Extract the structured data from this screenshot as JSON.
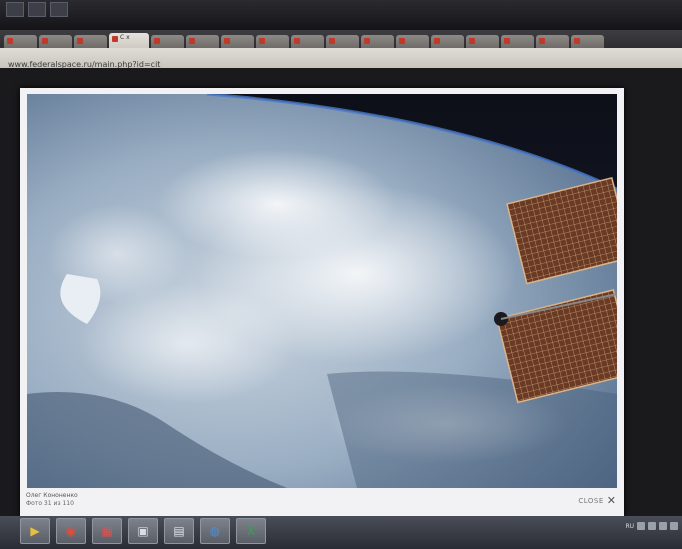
{
  "browser": {
    "url": "www.federalspace.ru/main.php?id=cit",
    "tabs_count": 17,
    "active_tab_label": "C  x"
  },
  "lightbox": {
    "caption_title": "Олег Кононенко",
    "caption_count": "Фото 31 из 110",
    "close_label": "CLOSE",
    "close_glyph": "✕"
  },
  "taskbar": {
    "items": [
      {
        "name": "media-player",
        "glyph": "▶",
        "color": "#e8c040"
      },
      {
        "name": "chrome",
        "glyph": "◉",
        "color": "#e84a3a"
      },
      {
        "name": "app-red",
        "glyph": "▦",
        "color": "#e05050"
      },
      {
        "name": "app-window",
        "glyph": "▣",
        "color": "#d8dde8"
      },
      {
        "name": "calculator",
        "glyph": "▤",
        "color": "#dfe3ea"
      },
      {
        "name": "globe",
        "glyph": "◍",
        "color": "#4a90d8"
      },
      {
        "name": "excel",
        "glyph": "X",
        "color": "#3aa050"
      }
    ],
    "tray_language": "RU"
  }
}
